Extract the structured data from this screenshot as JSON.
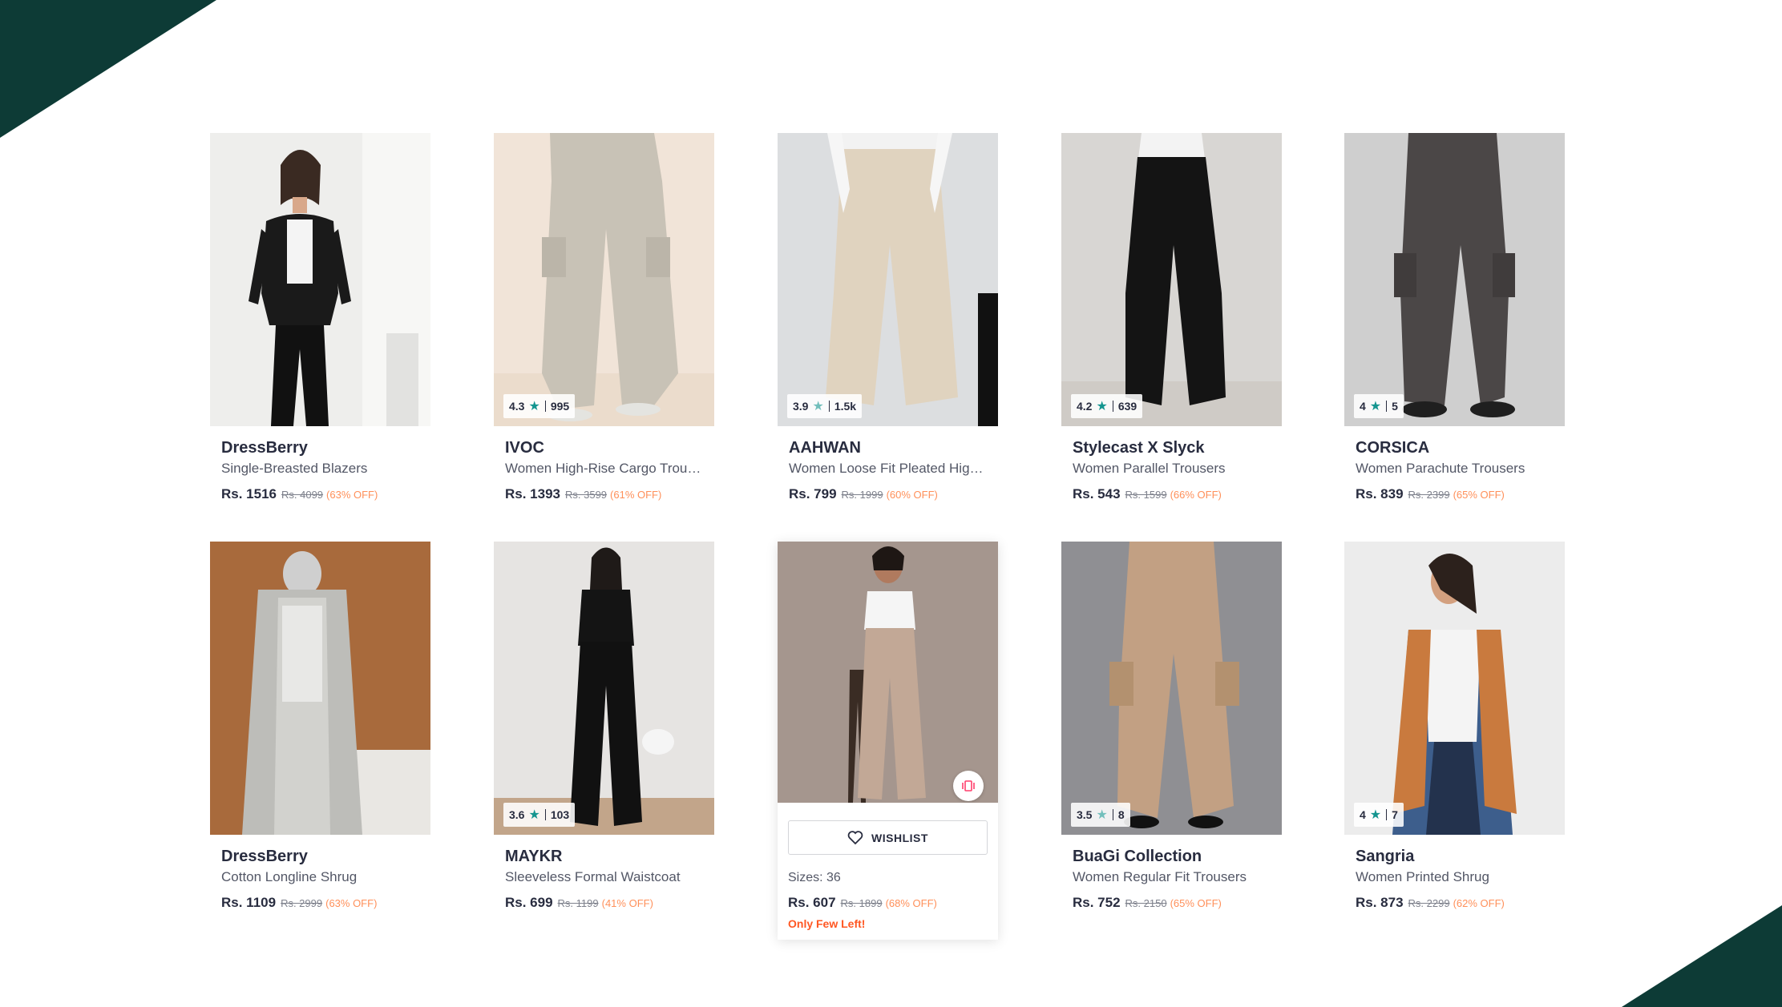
{
  "products": [
    {
      "brand": "DressBerry",
      "name": "Single-Breasted Blazers",
      "price": "Rs. 1516",
      "mrp": "Rs. 4099",
      "off": "(63% OFF)",
      "image": "woman-black-blazer-photo"
    },
    {
      "brand": "IVOC",
      "name": "Women High-Rise Cargo Trous…",
      "price": "Rs. 1393",
      "mrp": "Rs. 3599",
      "off": "(61% OFF)",
      "rating": "4.3",
      "count": "995",
      "image": "beige-cargo-trousers-photo"
    },
    {
      "brand": "AAHWAN",
      "name": "Women Loose Fit Pleated High…",
      "price": "Rs. 799",
      "mrp": "Rs. 1999",
      "off": "(60% OFF)",
      "rating": "3.9",
      "count": "1.5k",
      "image": "cream-pleated-trousers-photo"
    },
    {
      "brand": "Stylecast X Slyck",
      "name": "Women Parallel Trousers",
      "price": "Rs. 543",
      "mrp": "Rs. 1599",
      "off": "(66% OFF)",
      "rating": "4.2",
      "count": "639",
      "image": "black-parallel-trousers-photo"
    },
    {
      "brand": "CORSICA",
      "name": "Women Parachute Trousers",
      "price": "Rs. 839",
      "mrp": "Rs. 2399",
      "off": "(65% OFF)",
      "rating": "4",
      "count": "5",
      "image": "grey-parachute-trousers-photo"
    },
    {
      "brand": "DressBerry",
      "name": "Cotton Longline Shrug",
      "price": "Rs. 1109",
      "mrp": "Rs. 2999",
      "off": "(63% OFF)",
      "image": "grey-knit-shrug-photo"
    },
    {
      "brand": "MAYKR",
      "name": "Sleeveless Formal Waistcoat",
      "price": "Rs. 699",
      "mrp": "Rs. 1199",
      "off": "(41% OFF)",
      "rating": "3.6",
      "count": "103",
      "image": "black-waistcoat-photo"
    },
    {
      "price": "Rs. 607",
      "mrp": "Rs. 1899",
      "off": "(68% OFF)",
      "wishlist": "WISHLIST",
      "sizes": "Sizes: 36",
      "few_left": "Only Few Left!",
      "image": "beige-trousers-white-top-photo"
    },
    {
      "brand": "BuaGi Collection",
      "name": "Women Regular Fit Trousers",
      "price": "Rs. 752",
      "mrp": "Rs. 2150",
      "off": "(65% OFF)",
      "rating": "3.5",
      "count": "8",
      "image": "tan-cargo-trousers-photo"
    },
    {
      "brand": "Sangria",
      "name": "Women Printed Shrug",
      "price": "Rs. 873",
      "mrp": "Rs. 2299",
      "off": "(62% OFF)",
      "rating": "4",
      "count": "7",
      "image": "printed-shrug-photo"
    }
  ],
  "icons": {
    "rating": "star-icon",
    "wishlist": "heart-icon",
    "similar": "view-similar-icon"
  },
  "colors": {
    "corner": "#0d3b36",
    "star": "#14958f",
    "discount": "#ff905a",
    "few_left": "#ff5722"
  }
}
